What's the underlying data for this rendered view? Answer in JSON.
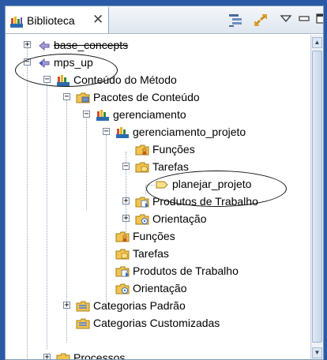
{
  "view": {
    "tab_title": "Biblioteca",
    "close_glyph": "✕",
    "toolbar": [
      "collapse-all-icon",
      "link-with-editor-icon",
      "view-menu-icon",
      "minimize-icon",
      "maximize-icon"
    ]
  },
  "tree": {
    "items": [
      {
        "label": "base_concepts"
      },
      {
        "label": "mps_up"
      },
      {
        "label": "Conteúdo do Método"
      },
      {
        "label": "Pacotes de Conteúdo"
      },
      {
        "label": "gerenciamento"
      },
      {
        "label": "gerenciamento_projeto"
      },
      {
        "label": "Funções"
      },
      {
        "label": "Tarefas"
      },
      {
        "label": "planejar_projeto"
      },
      {
        "label": "Produtos de Trabalho"
      },
      {
        "label": "Orientação"
      },
      {
        "label": "Funções"
      },
      {
        "label": "Tarefas"
      },
      {
        "label": "Produtos de Trabalho"
      },
      {
        "label": "Orientação"
      },
      {
        "label": "Categorias Padrão"
      },
      {
        "label": "Categorias Customizadas"
      },
      {
        "label": "Processos"
      }
    ]
  },
  "colors": {
    "background": "#2a5aa6",
    "folder": "#f2c34e",
    "plugin": "#8a7bc0",
    "method": "#3a8a3a"
  }
}
